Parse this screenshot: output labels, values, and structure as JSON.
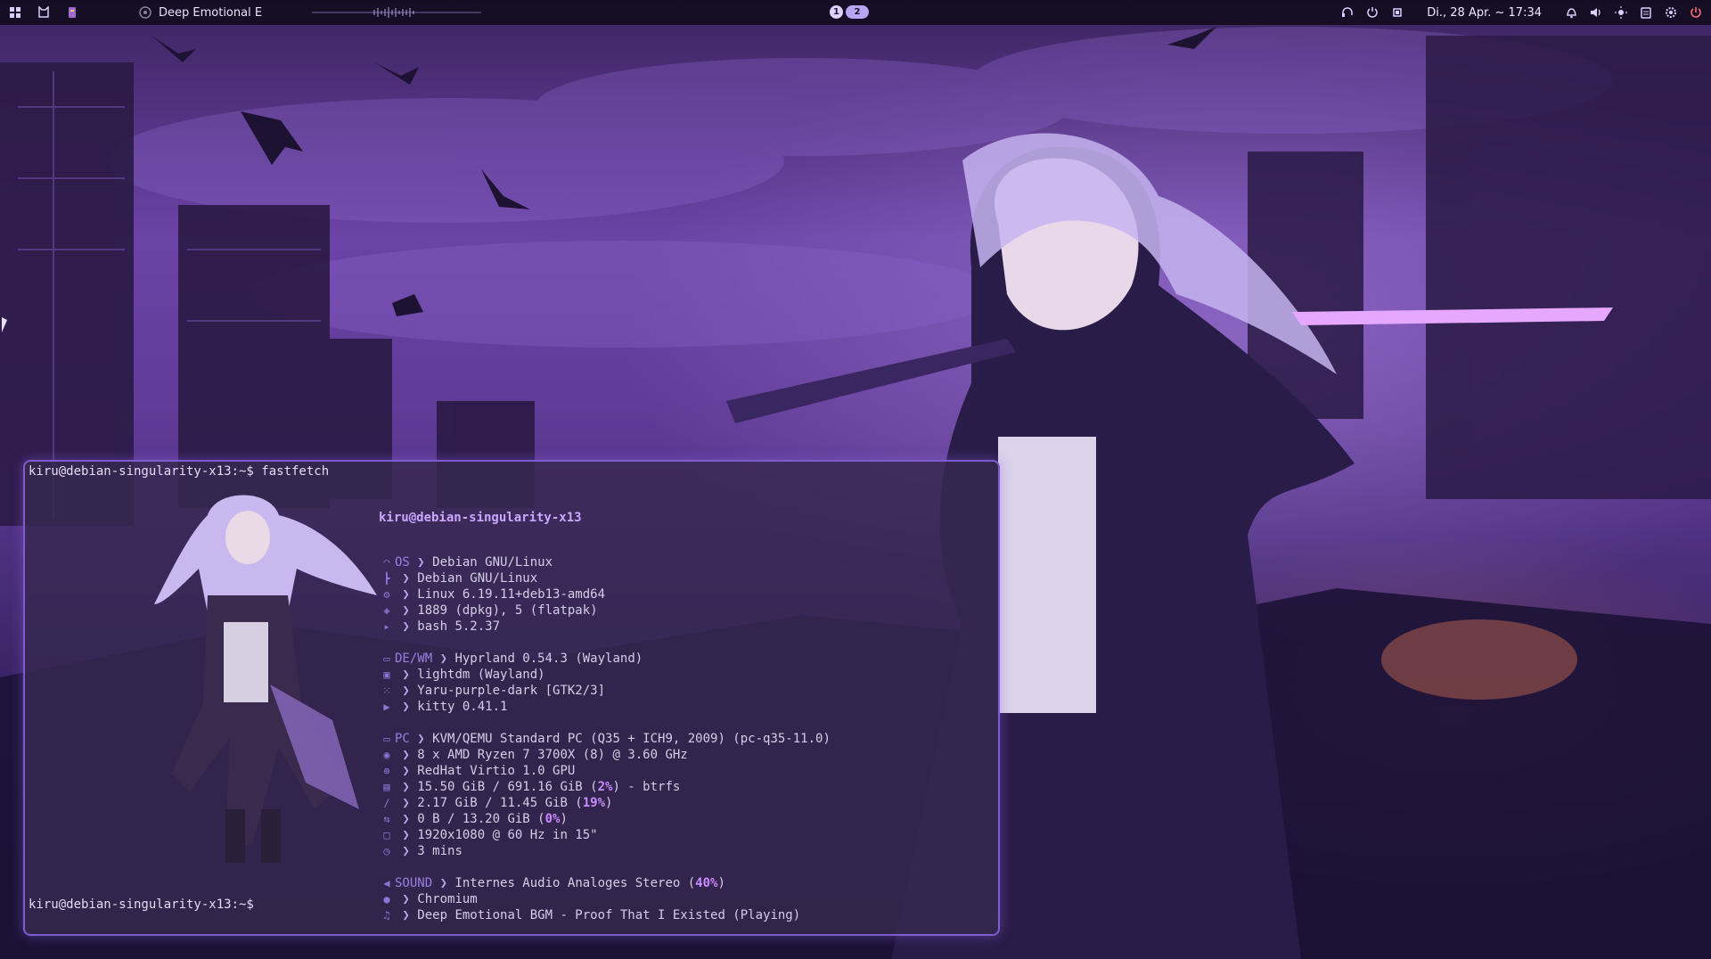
{
  "topbar": {
    "media_title": "Deep Emotional E",
    "workspaces": [
      "1",
      "2"
    ],
    "clock": "Di., 28 Apr. ~ 17:34",
    "left_icons": [
      "apps-grid-icon",
      "kitty-cat-icon",
      "media-player-icon",
      "disc-icon"
    ],
    "right_icons": [
      "headset-icon",
      "power-cycle-icon",
      "cpu-icon",
      "bell-icon",
      "volume-icon",
      "brightness-icon",
      "clipboard-icon",
      "settings-gear-icon",
      "power-icon"
    ]
  },
  "terminal": {
    "prompt_command": "kiru@debian-singularity-x13:~$ fastfetch",
    "prompt_idle": "kiru@debian-singularity-x13:~$",
    "header": "kiru@debian-singularity-x13",
    "arrow": "❯",
    "sections": [
      {
        "lines": [
          {
            "key": "OS",
            "value": "Debian GNU/Linux",
            "icon": "debian-icon"
          },
          {
            "key": "",
            "value": "Debian GNU/Linux",
            "icon": "tree-branch-icon"
          },
          {
            "key": "",
            "value": "Linux 6.19.11+deb13-amd64",
            "icon": "gear-icon"
          },
          {
            "key": "",
            "value": "1889 (dpkg), 5 (flatpak)",
            "icon": "package-icon"
          },
          {
            "key": "",
            "value": "bash 5.2.37",
            "icon": "shell-icon"
          }
        ]
      },
      {
        "lines": [
          {
            "key": "DE/WM",
            "value": "Hyprland 0.54.3 (Wayland)",
            "icon": "desktop-icon"
          },
          {
            "key": "",
            "value": "lightdm (Wayland)",
            "icon": "monitor-icon"
          },
          {
            "key": "",
            "value": "Yaru-purple-dark [GTK2/3]",
            "icon": "grid-icon"
          },
          {
            "key": "",
            "value": "kitty 0.41.1",
            "icon": "terminal-icon"
          }
        ]
      },
      {
        "lines": [
          {
            "key": "PC",
            "value": "KVM/QEMU Standard PC (Q35 + ICH9, 2009) (pc-q35-11.0)",
            "icon": "laptop-icon"
          },
          {
            "key": "",
            "value": "8 x AMD Ryzen 7 3700X (8) @ 3.60 GHz",
            "icon": "cpu-icon"
          },
          {
            "key": "",
            "value": "RedHat Virtio 1.0 GPU",
            "icon": "gpu-icon"
          },
          {
            "key": "",
            "value": "15.50 GiB / 691.16 GiB (",
            "highlight": "2%",
            "suffix": ") - btrfs",
            "icon": "disk-icon"
          },
          {
            "key": "",
            "value": "2.17 GiB / 11.45 GiB (",
            "highlight": "19%",
            "suffix": ")",
            "icon": "memory-icon"
          },
          {
            "key": "",
            "value": "0 B / 13.20 GiB (",
            "highlight": "0%",
            "suffix": ")",
            "icon": "swap-icon"
          },
          {
            "key": "",
            "value": "1920x1080 @ 60 Hz in 15\"",
            "icon": "display-icon"
          },
          {
            "key": "",
            "value": "3 mins",
            "icon": "clock-icon"
          }
        ]
      },
      {
        "lines": [
          {
            "key": "SOUND",
            "value": "Internes Audio Analoges Stereo (",
            "highlight": "40%",
            "suffix": ")",
            "icon": "speaker-icon"
          },
          {
            "key": "",
            "value": "Chromium",
            "icon": "user-icon"
          },
          {
            "key": "",
            "value": "Deep Emotional BGM - Proof That I Existed (Playing)",
            "icon": "music-note-icon"
          }
        ]
      }
    ]
  }
}
